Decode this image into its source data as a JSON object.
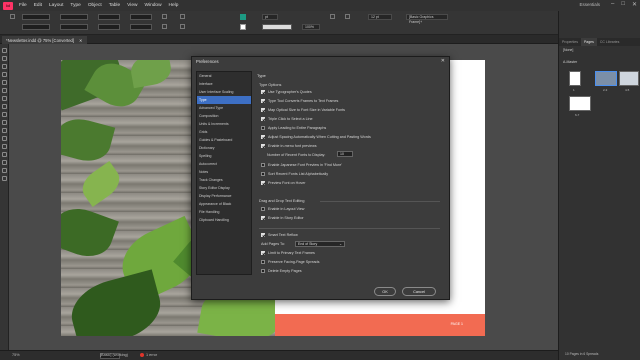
{
  "app": {
    "logo": "Id",
    "window_controls": [
      "–",
      "□",
      "✕"
    ],
    "workspace": "Essentials"
  },
  "menu": [
    "File",
    "Edit",
    "Layout",
    "Type",
    "Object",
    "Table",
    "View",
    "Window",
    "Help"
  ],
  "control_bar": {
    "font_size_unit": "pt",
    "zoom_percent": "100%",
    "frame_style": "[Basic Graphics Frame]+",
    "stroke_weight": "12 pt"
  },
  "document_tab": {
    "title": "*Newsletter.indd @ 75% [Converted]",
    "close": "✕"
  },
  "page": {
    "body_text": "",
    "footer_label": "PAGE 1",
    "colors": {
      "footer_band": "#f26b52"
    }
  },
  "status_bar": {
    "zoom": "75%",
    "page_field": "",
    "style": "[Basic] (working)",
    "preflight": "1 error"
  },
  "right_panel": {
    "tabs": [
      "Properties",
      "Pages",
      "CC Libraries"
    ],
    "active_tab": "Pages",
    "none_label": "[None]",
    "master_label": "A-Master",
    "thumb_labels": [
      "1",
      "2-3",
      "4-5",
      "6-7"
    ],
    "footer": "10 Pages in 6 Spreads"
  },
  "dialog": {
    "title": "Preferences",
    "close": "✕",
    "section": "Type",
    "categories": [
      "General",
      "Interface",
      "User Interface Scaling",
      "Type",
      "Advanced Type",
      "Composition",
      "Units & Increments",
      "Grids",
      "Guides & Pasteboard",
      "Dictionary",
      "Spelling",
      "Autocorrect",
      "Notes",
      "Track Changes",
      "Story Editor Display",
      "Display Performance",
      "Appearance of Black",
      "File Handling",
      "Clipboard Handling"
    ],
    "selected_category": "Type",
    "type_options": {
      "title": "Type Options",
      "items": [
        {
          "label": "Use Typographer's Quotes",
          "checked": true
        },
        {
          "label": "Type Tool Converts Frames to Text Frames",
          "checked": true
        },
        {
          "label": "Map Optical Size to Font Size in Variable Fonts",
          "checked": true
        },
        {
          "label": "Triple Click to Select a Line",
          "checked": true
        },
        {
          "label": "Apply Leading to Entire Paragraphs",
          "checked": false
        },
        {
          "label": "Adjust Spacing Automatically When Cutting and Pasting Words",
          "checked": true
        },
        {
          "label": "Enable in-menu font previews",
          "checked": true
        }
      ],
      "recent_fonts_label": "Number of Recent Fonts to Display:",
      "recent_fonts_value": "10",
      "items2": [
        {
          "label": "Enable Japanese Font Preview in 'Find More'",
          "checked": false
        },
        {
          "label": "Sort Recent Fonts List Alphabetically",
          "checked": false
        },
        {
          "label": "Preview Font on Hover",
          "checked": true
        }
      ]
    },
    "drag_drop": {
      "title": "Drag and Drop Text Editing",
      "items": [
        {
          "label": "Enable in Layout View",
          "checked": false
        },
        {
          "label": "Enable in Story Editor",
          "checked": true
        }
      ]
    },
    "smart_reflow": {
      "label": "Smart Text Reflow",
      "checked": true,
      "add_pages_label": "Add Pages To:",
      "add_pages_value": "End of Story",
      "items": [
        {
          "label": "Limit to Primary Text Frames",
          "checked": true
        },
        {
          "label": "Preserve Facing-Page Spreads",
          "checked": false
        },
        {
          "label": "Delete Empty Pages",
          "checked": false
        }
      ]
    },
    "ok_label": "OK",
    "cancel_label": "Cancel"
  }
}
